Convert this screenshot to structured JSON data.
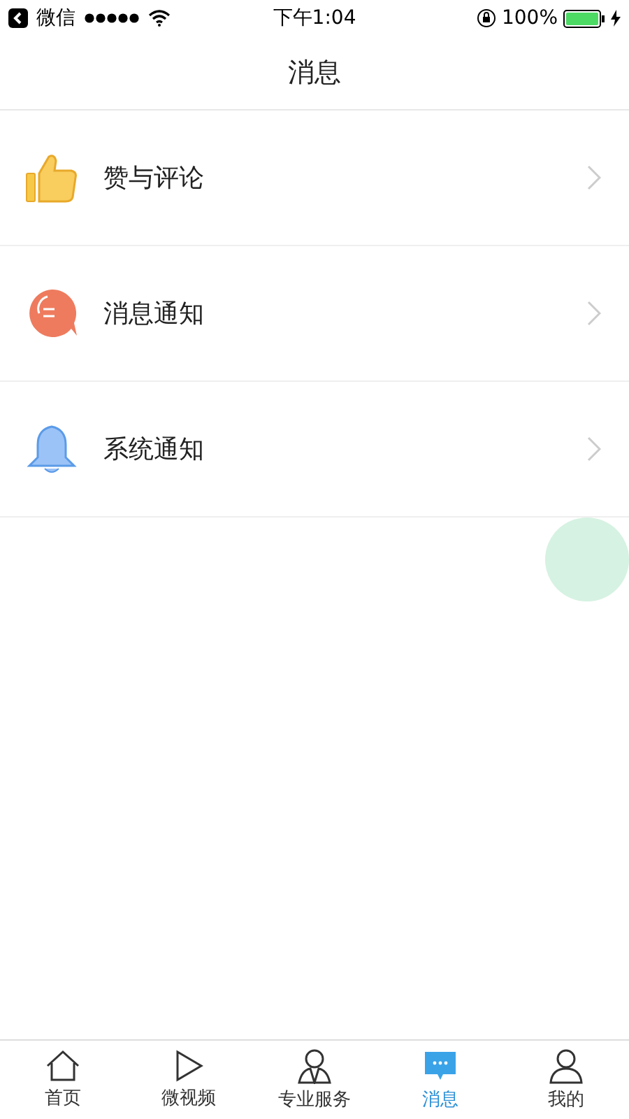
{
  "status_bar": {
    "back_app": "微信",
    "time": "下午1:04",
    "battery": "100%"
  },
  "nav": {
    "title": "消息"
  },
  "items": [
    {
      "label": "赞与评论"
    },
    {
      "label": "消息通知"
    },
    {
      "label": "系统通知"
    }
  ],
  "tabs": [
    {
      "label": "首页",
      "selected": false
    },
    {
      "label": "微视频",
      "selected": false
    },
    {
      "label": "专业服务",
      "selected": false
    },
    {
      "label": "消息",
      "selected": true
    },
    {
      "label": "我的",
      "selected": false
    }
  ]
}
